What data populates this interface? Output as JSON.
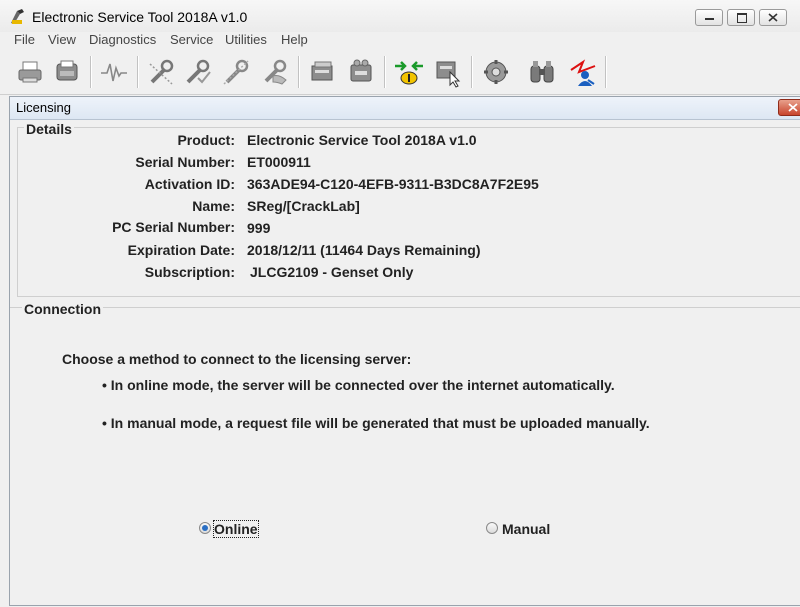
{
  "window": {
    "title": "Electronic Service Tool 2018A v1.0",
    "buttons": {
      "minimize": "—",
      "maximize": "□",
      "close": "✕"
    }
  },
  "menu": {
    "items": [
      "File",
      "View",
      "Diagnostics",
      "Service",
      "Utilities",
      "Help"
    ]
  },
  "toolbar": {
    "icons": [
      "printer-icon",
      "fax-icon",
      "waveform-icon",
      "wrench-strikethrough-icon",
      "wrench-check-icon",
      "wrench-strikethrough-alt-icon",
      "wrench-hand-icon",
      "document-stack-icon",
      "document-control-icon",
      "connect-arrows-icon",
      "document-cursor-icon",
      "gear-globe-icon",
      "binoculars-icon",
      "lightning-user-icon"
    ]
  },
  "dialog": {
    "title": "Licensing",
    "close_glyph": "x",
    "details": {
      "label": "Details",
      "rows": [
        {
          "label": "Product:",
          "value": "Electronic Service Tool 2018A v1.0"
        },
        {
          "label": "Serial Number:",
          "value": "ET000911"
        },
        {
          "label": "Activation ID:",
          "value": "363ADE94-C120-4EFB-9311-B3DC8A7F2E95"
        },
        {
          "label": "Name:",
          "value": "SReg/[CrackLab]"
        },
        {
          "label": "PC Serial Number:",
          "value": "999"
        },
        {
          "label": "Expiration Date:",
          "value": "2018/12/11 (11464 Days Remaining)"
        },
        {
          "label": "Subscription:",
          "value": "JLCG2109 - Genset Only"
        }
      ]
    },
    "connection": {
      "label": "Connection",
      "intro": "Choose a method to connect to the licensing server:",
      "bullets": [
        "• In online mode, the server will be connected over the internet automatically.",
        "• In manual mode, a request file will be generated that must be uploaded manually."
      ],
      "options": [
        {
          "label": "Online",
          "selected": true
        },
        {
          "label": "Manual",
          "selected": false
        }
      ]
    }
  },
  "colors": {
    "accent_blue": "#2a6fc4",
    "close_red": "#c8452d"
  }
}
